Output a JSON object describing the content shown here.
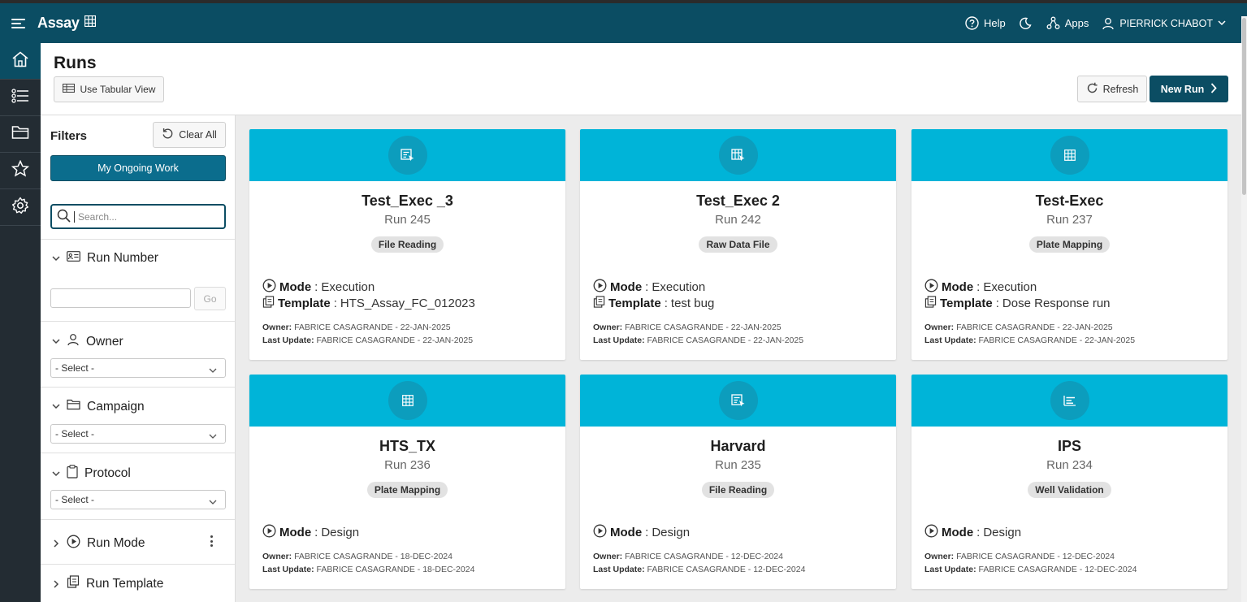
{
  "app": {
    "title": "Assay",
    "help_label": "Help",
    "apps_label": "Apps",
    "user_name": "PIERRICK CHABOT"
  },
  "page": {
    "title": "Runs",
    "tabular_view_label": "Use Tabular View",
    "refresh_label": "Refresh",
    "new_run_label": "New Run"
  },
  "filters": {
    "title": "Filters",
    "clear_all_label": "Clear All",
    "ongoing_label": "My Ongoing Work",
    "search_placeholder": "Search...",
    "run_number": {
      "label": "Run Number",
      "go_label": "Go"
    },
    "owner": {
      "label": "Owner",
      "selected": "- Select -"
    },
    "campaign": {
      "label": "Campaign",
      "selected": "- Select -"
    },
    "protocol": {
      "label": "Protocol",
      "selected": "- Select -"
    },
    "run_mode": {
      "label": "Run Mode"
    },
    "run_template": {
      "label": "Run Template"
    }
  },
  "labels": {
    "mode": "Mode",
    "template": "Template",
    "owner": "Owner:",
    "last_update": "Last Update:"
  },
  "colors": {
    "header": "#0b4d63",
    "card_banner": "#00b4d8",
    "rail": "#232c33"
  },
  "cards": [
    {
      "name": "Test_Exec _3",
      "run": "Run 245",
      "status": "File Reading",
      "icon": "file-reading-icon",
      "mode": "Execution",
      "template": "HTS_Assay_FC_012023",
      "owner": "FABRICE CASAGRANDE - 22-JAN-2025",
      "last_update": "FABRICE CASAGRANDE - 22-JAN-2025"
    },
    {
      "name": "Test_Exec 2",
      "run": "Run 242",
      "status": "Raw Data File",
      "icon": "raw-data-file-icon",
      "mode": "Execution",
      "template": "test bug",
      "owner": "FABRICE CASAGRANDE - 22-JAN-2025",
      "last_update": "FABRICE CASAGRANDE - 22-JAN-2025"
    },
    {
      "name": "Test-Exec",
      "run": "Run 237",
      "status": "Plate Mapping",
      "icon": "plate-grid-icon",
      "mode": "Execution",
      "template": "Dose Response run",
      "owner": "FABRICE CASAGRANDE - 22-JAN-2025",
      "last_update": "FABRICE CASAGRANDE - 22-JAN-2025"
    },
    {
      "name": "HTS_TX",
      "run": "Run 236",
      "status": "Plate Mapping",
      "icon": "plate-grid-icon",
      "mode": "Design",
      "owner": "FABRICE CASAGRANDE - 18-DEC-2024",
      "last_update": "FABRICE CASAGRANDE - 18-DEC-2024"
    },
    {
      "name": "Harvard",
      "run": "Run 235",
      "status": "File Reading",
      "icon": "file-reading-icon",
      "mode": "Design",
      "owner": "FABRICE CASAGRANDE - 12-DEC-2024",
      "last_update": "FABRICE CASAGRANDE - 12-DEC-2024"
    },
    {
      "name": "IPS",
      "run": "Run 234",
      "status": "Well Validation",
      "icon": "well-validation-icon",
      "mode": "Design",
      "owner": "FABRICE CASAGRANDE - 12-DEC-2024",
      "last_update": "FABRICE CASAGRANDE - 12-DEC-2024"
    }
  ]
}
